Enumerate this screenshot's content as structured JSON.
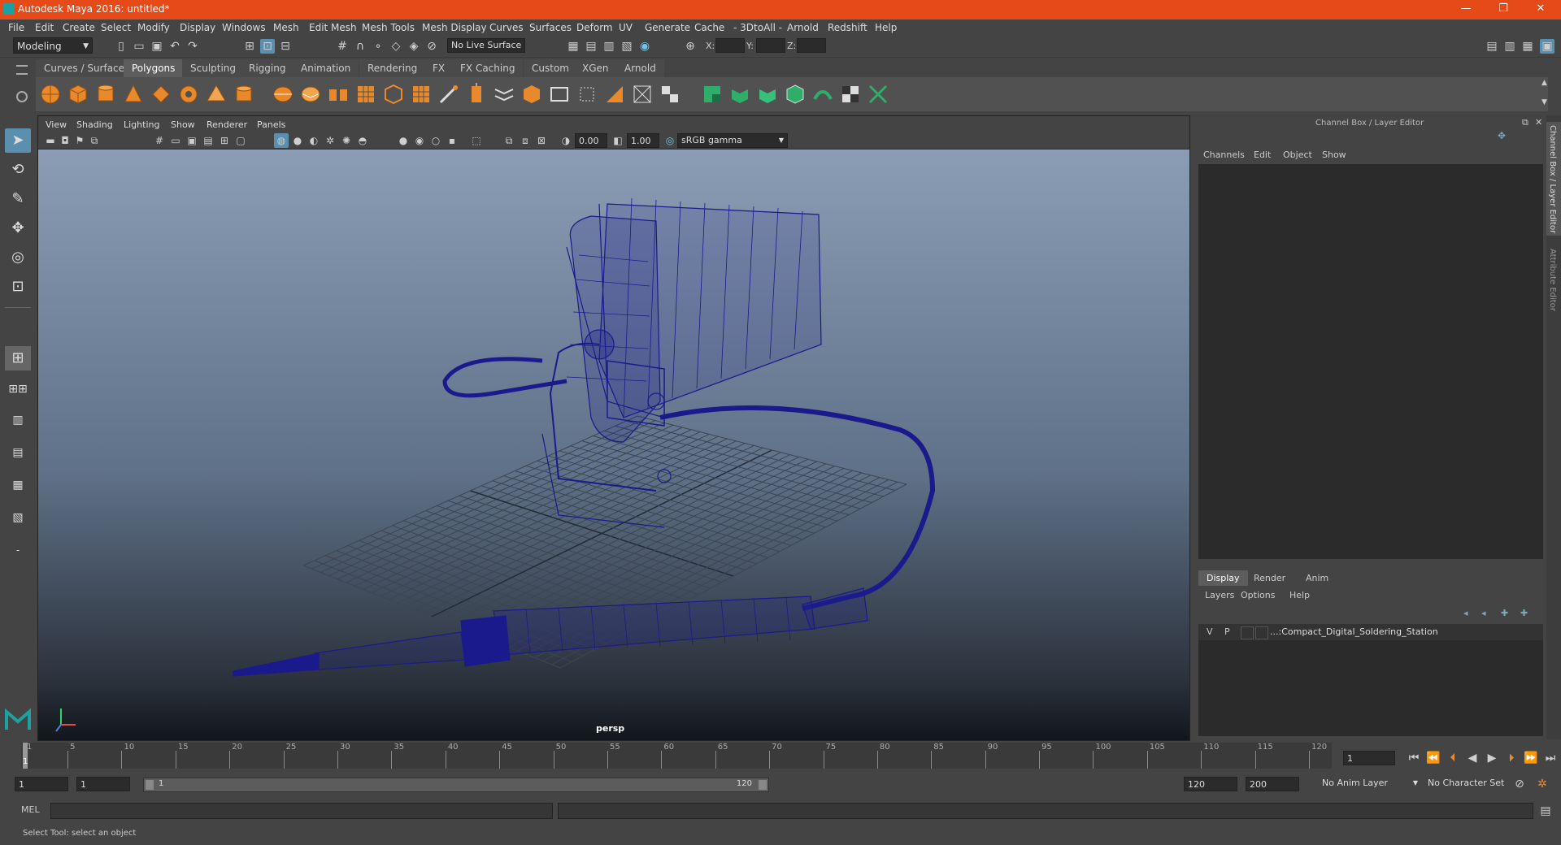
{
  "window": {
    "title": "Autodesk Maya 2016: untitled*",
    "minimize": "—",
    "restore": "❐",
    "close": "✕"
  },
  "menus": [
    "File",
    "Edit",
    "Create",
    "Select",
    "Modify",
    "Display",
    "Windows",
    "Mesh",
    "Edit Mesh",
    "Mesh Tools",
    "Mesh Display",
    "Curves",
    "Surfaces",
    "Deform",
    "UV",
    "Generate",
    "Cache",
    "- 3DtoAll -",
    "Arnold",
    "Redshift",
    "Help"
  ],
  "statusline": {
    "mode": "Modeling",
    "live_surface": "No Live Surface",
    "x_label": "X:",
    "y_label": "Y:",
    "z_label": "Z:"
  },
  "shelf_tabs": [
    "Curves / Surfaces",
    "Polygons",
    "Sculpting",
    "Rigging",
    "Animation",
    "Rendering",
    "FX",
    "FX Caching",
    "Custom",
    "XGen",
    "Arnold"
  ],
  "shelf_active": "Polygons",
  "viewport": {
    "menus": [
      "View",
      "Shading",
      "Lighting",
      "Show",
      "Renderer",
      "Panels"
    ],
    "exposure": "0.00",
    "gamma": "1.00",
    "color_space": "sRGB gamma",
    "camera": "persp"
  },
  "channel_box": {
    "title": "Channel Box / Layer Editor",
    "menus": [
      "Channels",
      "Edit",
      "Object",
      "Show"
    ],
    "layer_tabs": [
      "Display",
      "Render",
      "Anim"
    ],
    "layer_menus": [
      "Layers",
      "Options",
      "Help"
    ],
    "layer": {
      "v": "V",
      "p": "P",
      "name": "...:Compact_Digital_Soldering_Station"
    }
  },
  "side_tabs": [
    "Channel Box / Layer Editor",
    "Attribute Editor"
  ],
  "timeline": {
    "ticks": [
      "1",
      "5",
      "10",
      "15",
      "20",
      "25",
      "30",
      "35",
      "40",
      "45",
      "50",
      "55",
      "60",
      "65",
      "70",
      "75",
      "80",
      "85",
      "90",
      "95",
      "100",
      "105",
      "110",
      "115",
      "120"
    ],
    "current_frame": "1"
  },
  "range": {
    "start": "1",
    "playback_start": "1",
    "slider_start": "1",
    "slider_end": "120",
    "playback_end": "120",
    "end": "200",
    "anim_layer": "No Anim Layer",
    "char_set": "No Character Set"
  },
  "command": {
    "label": "MEL"
  },
  "help_line": "Select Tool: select an object",
  "colors": {
    "title_bar": "#e64a19",
    "accent": "#5b8fb0",
    "wire": "#1a1a8c"
  }
}
